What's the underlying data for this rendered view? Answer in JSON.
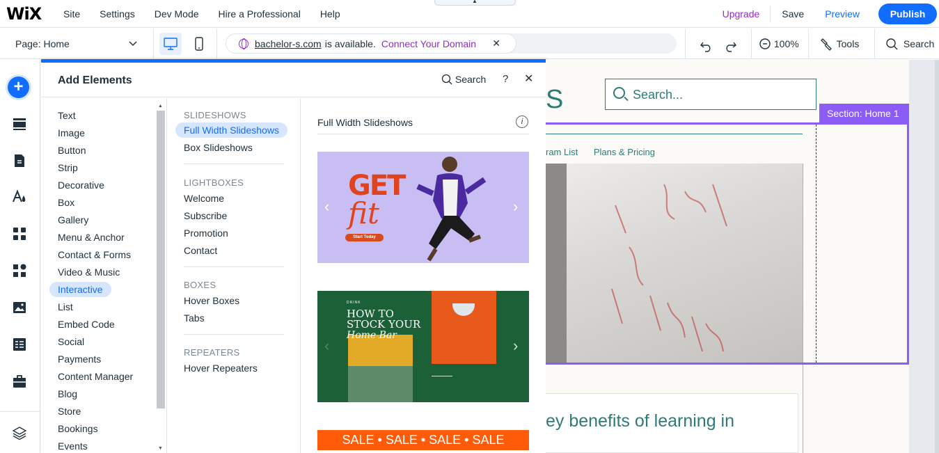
{
  "topbar": {
    "logo": "WiX",
    "menu": [
      "Site",
      "Settings",
      "Dev Mode",
      "Hire a Professional",
      "Help"
    ],
    "upgrade": "Upgrade",
    "save": "Save",
    "preview": "Preview",
    "publish": "Publish"
  },
  "bar2": {
    "page_label": "Page: Home",
    "domain": "bachelor-s.com",
    "available": "is available.",
    "connect": "Connect Your Domain",
    "zoom": "100%",
    "tools": "Tools",
    "search": "Search"
  },
  "panel": {
    "title": "Add Elements",
    "search": "Search",
    "help": "?",
    "categories": [
      "Text",
      "Image",
      "Button",
      "Strip",
      "Decorative",
      "Box",
      "Gallery",
      "Menu & Anchor",
      "Contact & Forms",
      "Video & Music",
      "Interactive",
      "List",
      "Embed Code",
      "Social",
      "Payments",
      "Content Manager",
      "Blog",
      "Store",
      "Bookings",
      "Events"
    ],
    "active_category": "Interactive",
    "groups": [
      {
        "title": "SLIDESHOWS",
        "items": [
          "Full Width Slideshows",
          "Box Slideshows"
        ]
      },
      {
        "title": "LIGHTBOXES",
        "items": [
          "Welcome",
          "Subscribe",
          "Promotion",
          "Contact"
        ]
      },
      {
        "title": "BOXES",
        "items": [
          "Hover Boxes",
          "Tabs"
        ]
      },
      {
        "title": "REPEATERS",
        "items": [
          "Hover Repeaters"
        ]
      }
    ],
    "active_item": "Full Width Slideshows",
    "preview_title": "Full Width Slideshows",
    "thumb1": {
      "get": "GET",
      "fit": "fit",
      "start": "Start Today"
    },
    "thumb2": {
      "drink": "DRINK",
      "line1": "HOW TO",
      "line2": "STOCK YOUR",
      "line3": "Home Bar"
    },
    "thumb3": {
      "text": "SALE • SALE • SALE • SALE"
    }
  },
  "canvas": {
    "logo_letter": "S",
    "search_placeholder": "Search...",
    "nav": [
      "ram List",
      "Plans & Pricing"
    ],
    "section_label": "Section: Home 1",
    "heading": "ey benefits of learning in"
  },
  "colors": {
    "accent": "#116dff",
    "upgrade": "#9a27d5",
    "section": "#8b5cf6",
    "site_teal": "#2f7a78"
  }
}
